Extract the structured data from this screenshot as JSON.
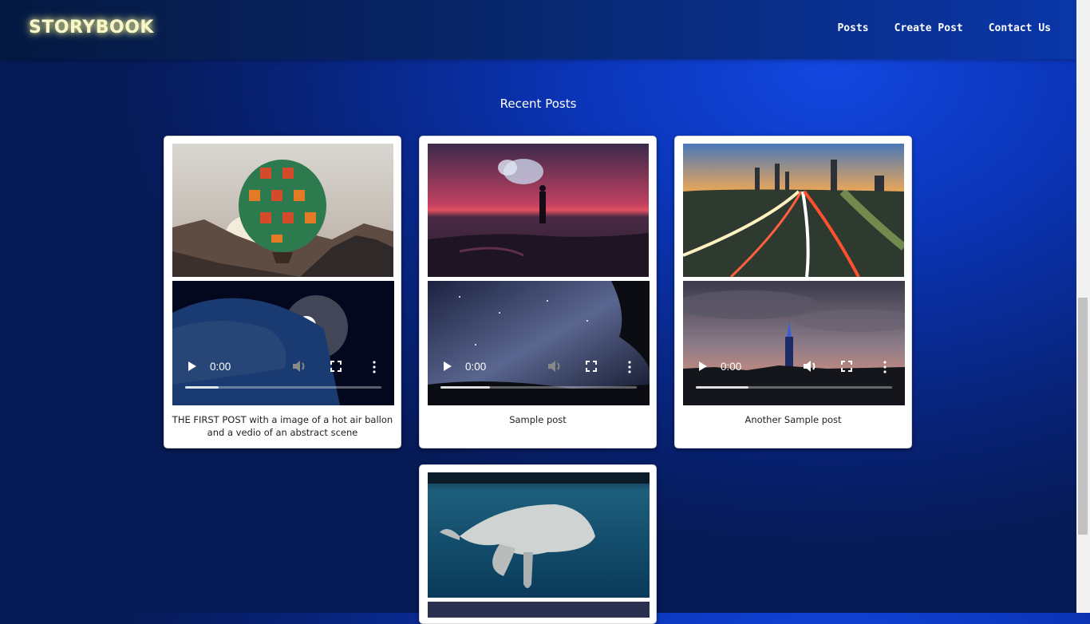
{
  "brand": "STORYBOOK",
  "nav": [
    "Posts",
    "Create Post",
    "Contact Us"
  ],
  "heading": "Recent Posts",
  "posts": [
    {
      "caption": "THE FIRST POST with a image of a hot air ballon and a vedio of an abstract scene",
      "image": "hot-air-balloon",
      "video_time": "0:00",
      "video_buffered": 0.17,
      "video_scene": "earth-from-space"
    },
    {
      "caption": "Sample post",
      "image": "person-with-smoke-flare-at-sunset",
      "video_time": "0:00",
      "video_buffered": 0.25,
      "video_scene": "milky-way-night-sky"
    },
    {
      "caption": "Another Sample post",
      "image": "city-highway-light-trails",
      "video_time": "0:00",
      "video_buffered": 0.27,
      "video_scene": "city-skyline-dusk"
    },
    {
      "caption": "",
      "image": "humpback-whale-underwater",
      "video_time": "",
      "video_buffered": 0,
      "video_scene": "night-sky"
    }
  ],
  "colors": {
    "accent_text": "#f7f7c8",
    "card_bg": "#ffffff"
  }
}
